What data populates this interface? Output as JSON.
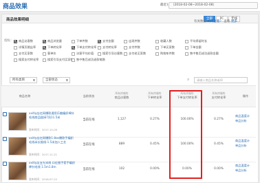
{
  "header": {
    "title": "商品效果",
    "date_label": "最近1天",
    "date_range": "（2018-02-08~2018-02-08）"
  },
  "panel": {
    "title": "商品效果明细",
    "segments": [
      "全部",
      "PC",
      "无线"
    ],
    "link_text1": "有关数据",
    "link_help": "如何查看？",
    "link_text2": "查看",
    "link_more": "更多"
  },
  "metrics": {
    "label": "指标：",
    "items": [
      {
        "label": "商品访客数",
        "checked": true
      },
      {
        "label": "商品浏览量",
        "checked": true
      },
      {
        "label": "下单件数",
        "checked": false
      },
      {
        "label": "支付金额",
        "checked": true
      },
      {
        "label": "出现件数",
        "checked": false
      },
      {
        "label": "收藏人数",
        "checked": false
      },
      {
        "label": "平均停留时长",
        "checked": false
      },
      {
        "label": "详情页跳出率",
        "checked": false
      },
      {
        "label": "下单转化率",
        "checked": true
      },
      {
        "label": "下单支付转化率",
        "checked": true
      },
      {
        "label": "支付转化率",
        "checked": false
      },
      {
        "label": "支付件数",
        "checked": false
      },
      {
        "label": "下单买家数",
        "checked": false
      },
      {
        "label": "下单金额",
        "checked": false
      },
      {
        "label": "支付买家数",
        "checked": false
      },
      {
        "label": "客单价",
        "checked": false
      },
      {
        "label": "访客平均价值",
        "checked": false
      },
      {
        "label": "搜索引导访客数",
        "checked": false
      },
      {
        "label": "支付老买家数",
        "checked": false
      },
      {
        "label": "购物车件数",
        "checked": false
      },
      {
        "label": "售中售后成功退款金额",
        "checked": false
      },
      {
        "label": "搜索支付转化率",
        "checked": false
      },
      {
        "label": "搜索引导支付买家数",
        "checked": false
      },
      {
        "label": "售中售后成功退款笔数",
        "checked": false
      }
    ],
    "hint": "* 最多只能同时选择5项指标"
  },
  "filters": {
    "category": "所有类目",
    "status": "全部状态",
    "search_placeholder": "请输入商品名称或ID"
  },
  "table": {
    "headers": [
      {
        "title": "商品名称",
        "sub": ""
      },
      {
        "title": "当前状态",
        "sub": ""
      },
      {
        "title": "商品访客数",
        "sub": "所有终端的"
      },
      {
        "title": "下单转化率",
        "sub": "所有终端的"
      },
      {
        "title": "下单支付转化率",
        "sub": "所有终端的"
      },
      {
        "title": "支付转化率",
        "sub": "所有终端的"
      },
      {
        "title": "操作",
        "sub": ""
      }
    ],
    "rows": [
      {
        "name": "xxitly店红网爆款通用乐趣编织棒针毛线商品链接7凤11.5米",
        "date": "发布时间：2017-10-09",
        "status": "当前在线",
        "visitors": "1,127",
        "order_rate": "0.27%",
        "pay_rate": "100.00%",
        "conv_rate": "0.27%",
        "op1": "商品温度计",
        "op2": "单品分析"
      },
      {
        "name": "xxitly店红网爆款1.8ox爆款手编织毛线半长细线-1.5米加入工艺",
        "date": "发布时间：2017-11-21",
        "status": "当前在线",
        "visitors": "889",
        "order_rate": "0.45%",
        "pay_rate": "100.00%",
        "conv_rate": "0.45%",
        "op1": "商品温度计",
        "op2": "单品分析"
      },
      {
        "name": "xxitly店五光米线 口红细手套手编织棒针毛线 1.5m1.8m",
        "date": "发布时间：2016-07-22",
        "status": "当前在线",
        "visitors": "102",
        "order_rate": "0.00%",
        "pay_rate": "0.00%",
        "conv_rate": "0.00%",
        "op1": "商品温度计",
        "op2": "单品分析"
      }
    ]
  }
}
